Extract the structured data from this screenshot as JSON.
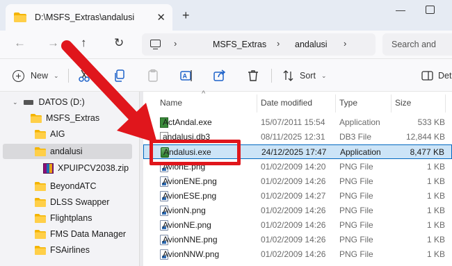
{
  "window": {
    "tab_title": "D:\\MSFS_Extras\\andalusi",
    "tab_close": "✕",
    "new_tab": "+",
    "minimize": "—"
  },
  "nav": {
    "back": "←",
    "forward": "→",
    "up": "↑",
    "refresh": "↻",
    "breadcrumbs": [
      "MSFS_Extras",
      "andalusi"
    ],
    "separator": "›",
    "search_placeholder": "Search and"
  },
  "toolbar": {
    "new_label": "New",
    "sort_label": "Sort",
    "details_label": "Det",
    "chevron": "⌄",
    "icons": [
      "cut-icon",
      "copy-icon",
      "paste-icon",
      "rename-icon",
      "share-icon",
      "delete-icon"
    ]
  },
  "sidebar": {
    "drive": "DATOS (D:)",
    "items": [
      {
        "label": "MSFS_Extras",
        "type": "folder"
      },
      {
        "label": "AIG",
        "type": "folder"
      },
      {
        "label": "andalusi",
        "type": "folder",
        "selected": true
      },
      {
        "label": "XPUIPCV2038.zip",
        "type": "zip"
      },
      {
        "label": "BeyondATC",
        "type": "folder"
      },
      {
        "label": "DLSS Swapper",
        "type": "folder"
      },
      {
        "label": "Flightplans",
        "type": "folder"
      },
      {
        "label": "FMS Data Manager",
        "type": "folder"
      },
      {
        "label": "FSAirlines",
        "type": "folder"
      }
    ]
  },
  "columns": {
    "name": "Name",
    "date": "Date modified",
    "type": "Type",
    "size": "Size"
  },
  "files": [
    {
      "name": "ActAndal.exe",
      "date": "15/07/2011 15:54",
      "type": "Application",
      "size": "533 KB",
      "icon": "exe"
    },
    {
      "name": "andalusi.db3",
      "date": "08/11/2025 12:31",
      "type": "DB3 File",
      "size": "12,844 KB",
      "icon": "db"
    },
    {
      "name": "Andalusi.exe",
      "date": "24/12/2025 17:47",
      "type": "Application",
      "size": "8,477 KB",
      "icon": "app",
      "selected": true
    },
    {
      "name": "AvionE.png",
      "date": "01/02/2009 14:20",
      "type": "PNG File",
      "size": "1 KB",
      "icon": "png"
    },
    {
      "name": "AvionENE.png",
      "date": "01/02/2009 14:26",
      "type": "PNG File",
      "size": "1 KB",
      "icon": "png"
    },
    {
      "name": "AvionESE.png",
      "date": "01/02/2009 14:27",
      "type": "PNG File",
      "size": "1 KB",
      "icon": "png"
    },
    {
      "name": "AvionN.png",
      "date": "01/02/2009 14:26",
      "type": "PNG File",
      "size": "1 KB",
      "icon": "png"
    },
    {
      "name": "AvionNE.png",
      "date": "01/02/2009 14:26",
      "type": "PNG File",
      "size": "1 KB",
      "icon": "png"
    },
    {
      "name": "AvionNNE.png",
      "date": "01/02/2009 14:26",
      "type": "PNG File",
      "size": "1 KB",
      "icon": "png"
    },
    {
      "name": "AvionNNW.png",
      "date": "01/02/2009 14:26",
      "type": "PNG File",
      "size": "1 KB",
      "icon": "png"
    }
  ],
  "annotation": {
    "color": "#e0161c"
  }
}
